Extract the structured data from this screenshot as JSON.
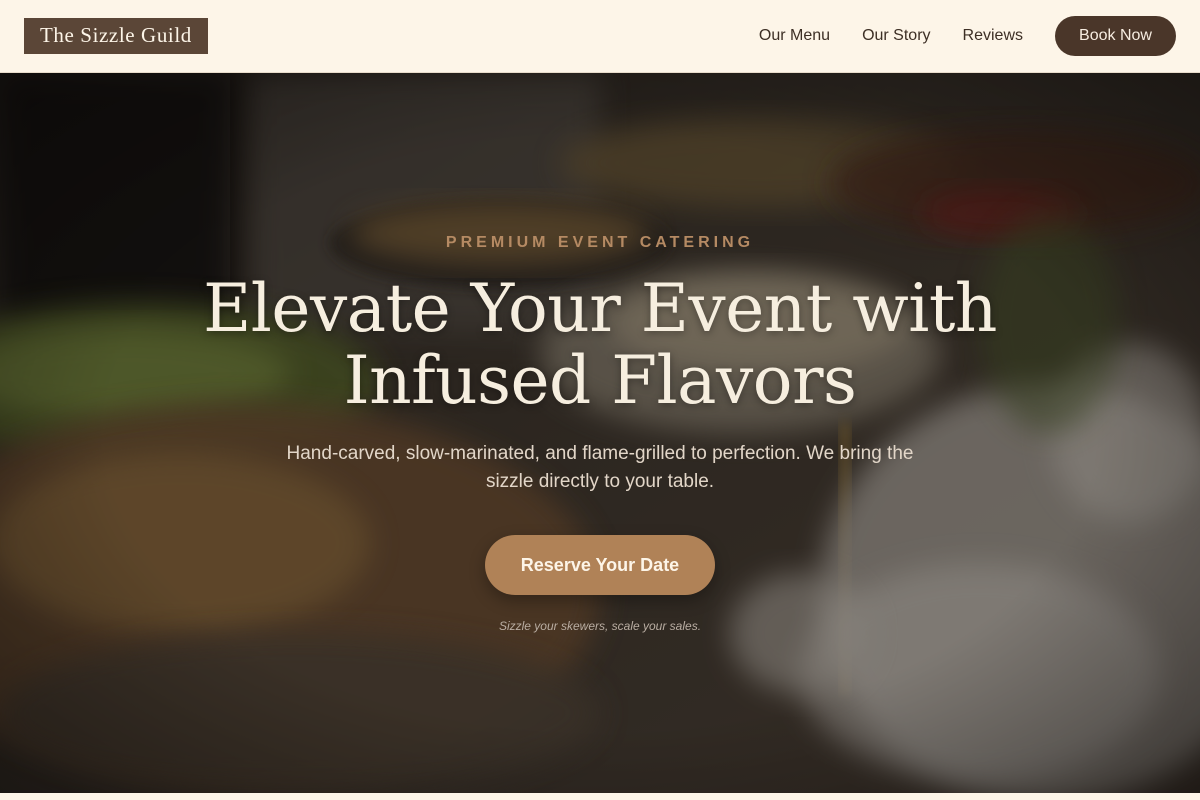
{
  "header": {
    "logo": "The Sizzle Guild",
    "nav": [
      {
        "label": "Our Menu"
      },
      {
        "label": "Our Story"
      },
      {
        "label": "Reviews"
      }
    ],
    "cta_label": "Book Now"
  },
  "hero": {
    "eyebrow": "PREMIUM EVENT CATERING",
    "title_line1": "Elevate Your Event with",
    "title_line2": "Infused Flavors",
    "subtitle_line1": "Hand-carved, slow-marinated, and flame-grilled to perfection. We bring the",
    "subtitle_line2": "sizzle directly to your table.",
    "button_label": "Reserve Your Date",
    "tagline": "Sizzle your skewers, scale your sales."
  },
  "colors": {
    "background": "#fdf5e8",
    "brand_dark": "#4a3629",
    "logo_bg": "#5b4637",
    "accent": "#b08257",
    "eyebrow": "#b58a63",
    "hero_text": "#f6eedf"
  },
  "icons": {
    "hero_image": "catering-buffet-photo"
  }
}
